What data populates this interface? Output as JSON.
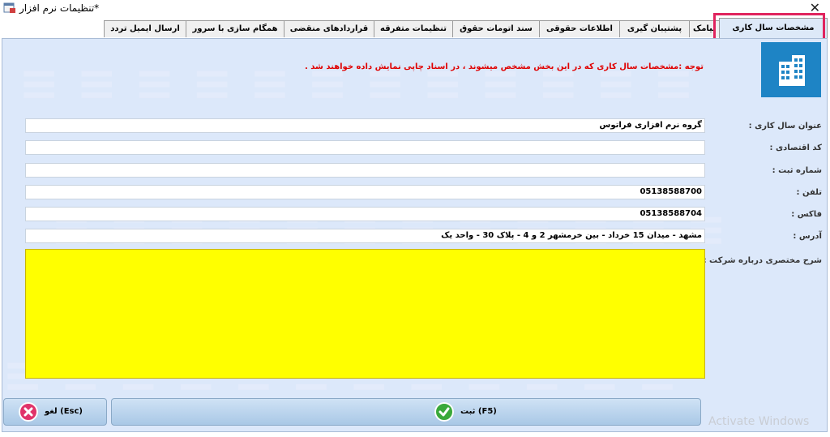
{
  "window": {
    "title": "تنظیمات نرم افزار*",
    "close_glyph": "✕"
  },
  "tabs": [
    {
      "label": "مشخصات سال کاری",
      "active": true
    },
    {
      "label": "پیامک"
    },
    {
      "label": "پشتیبان گیری"
    },
    {
      "label": "اطلاعات حقوقی"
    },
    {
      "label": "سند اتومات حقوق"
    },
    {
      "label": "تنظیمات متفرقه"
    },
    {
      "label": "قراردادهای منقضی"
    },
    {
      "label": "همگام سازی با سرور"
    },
    {
      "label": "ارسال ایمیل تردد"
    }
  ],
  "note": "توجه :مشخصات سال کاری که در این بخش مشخص میشوند ، در اسناد چاپی  نمایش داده خواهند شد .",
  "form": {
    "company_title": {
      "label": "عنوان سال کاری :",
      "value": "گروه نرم افزاری فراتوس"
    },
    "economic_code": {
      "label": "کد اقتصادی :",
      "value": ""
    },
    "registration_no": {
      "label": "شماره ثبت :",
      "value": ""
    },
    "phone": {
      "label": "تلفن :",
      "value": "05138588700"
    },
    "fax": {
      "label": "فاکس :",
      "value": "05138588704"
    },
    "address": {
      "label": "آدرس :",
      "value": "مشهد - میدان 15 خرداد - بین خرمشهر 2 و 4 - پلاک 30 - واحد یک"
    },
    "description": {
      "label": "شرح مختصری درباره شرکت :",
      "value": ""
    }
  },
  "buttons": {
    "cancel": "لغو  (Esc)",
    "submit": "ثبت  (F5)"
  },
  "watermark": "Activate Windows",
  "colors": {
    "panel": "#dce8fa",
    "highlight": "#e0245e",
    "description_bg": "#ffff00",
    "note": "#e00000",
    "logo_bg": "#1e84c5"
  }
}
